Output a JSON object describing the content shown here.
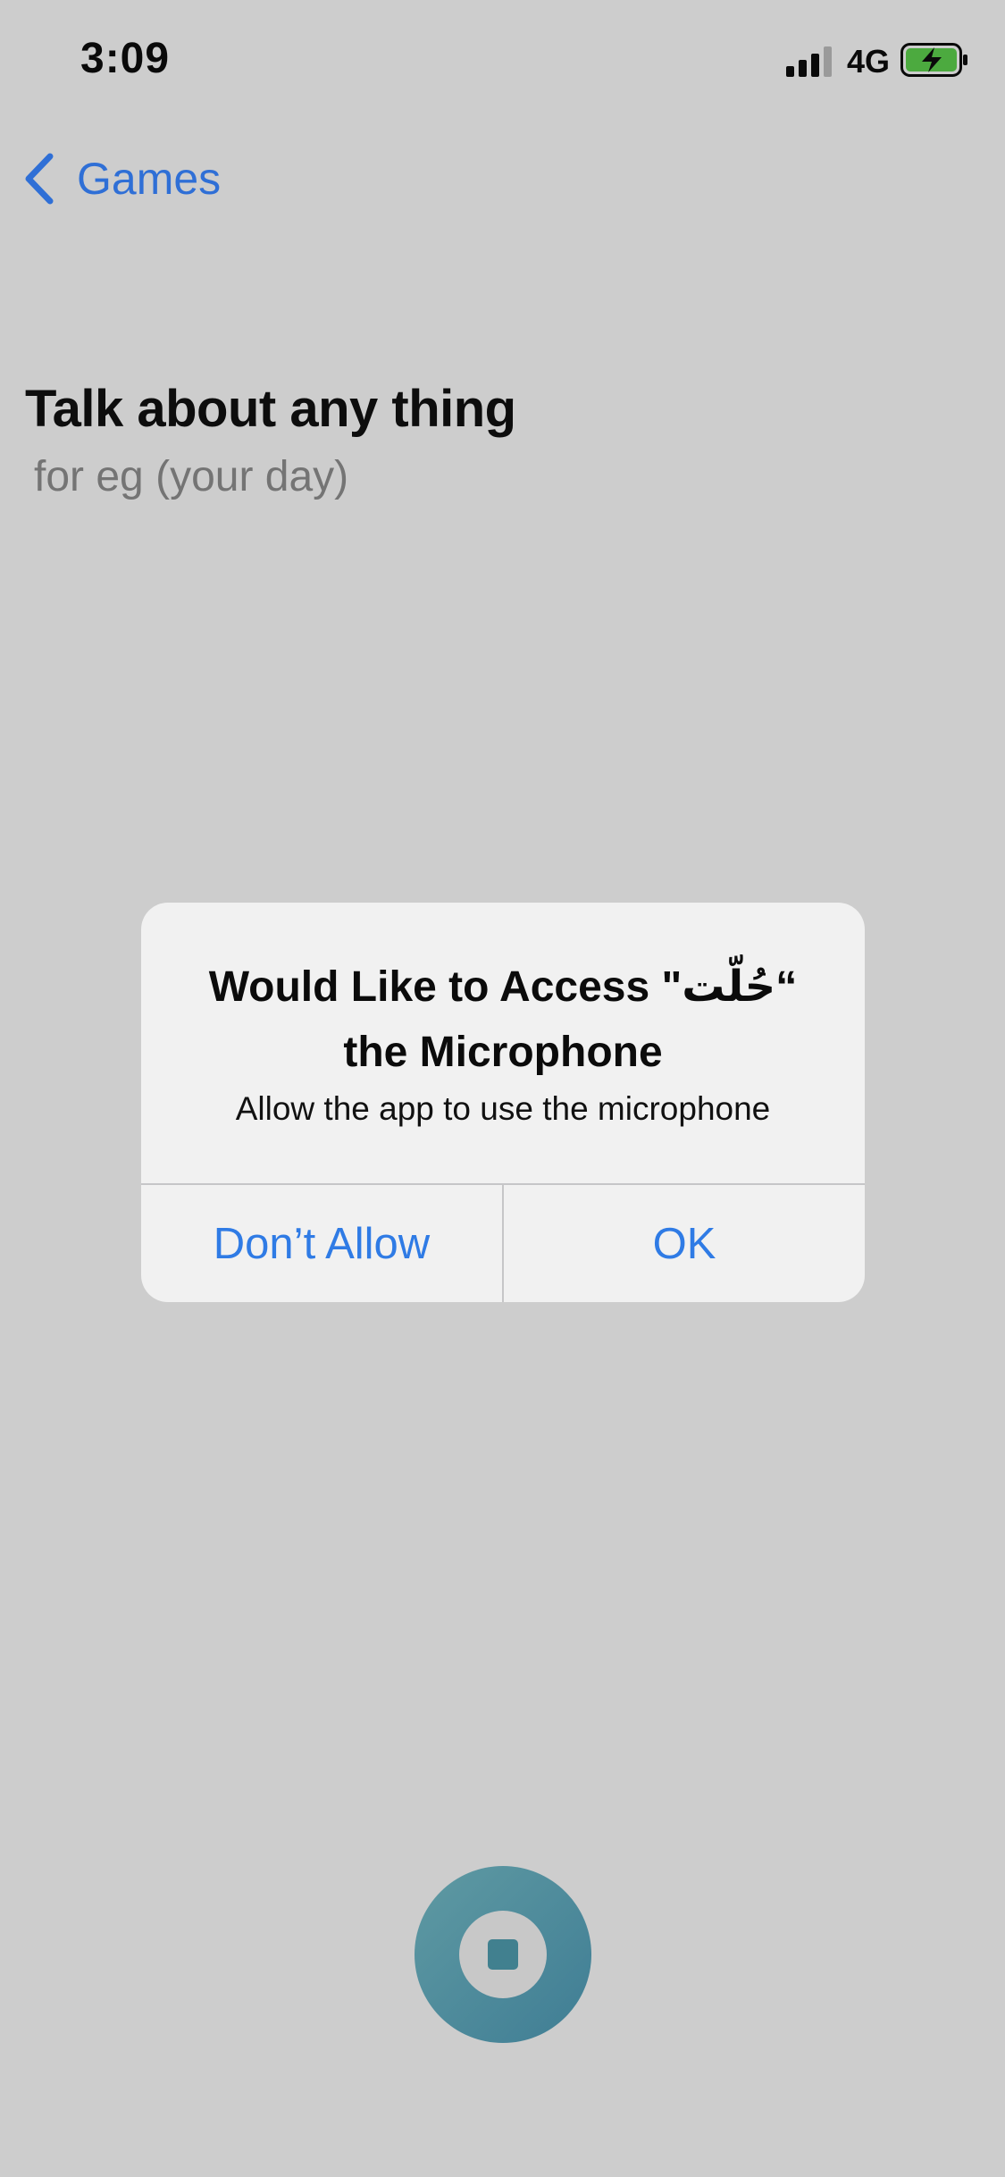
{
  "status_bar": {
    "time": "3:09",
    "network": "4G",
    "icons": [
      "signal-icon",
      "battery-charging-icon"
    ]
  },
  "nav": {
    "back_label": "Games",
    "icon": "chevron-left-icon"
  },
  "prompt": {
    "title": "Talk about any thing",
    "subtitle": "for eg (your day)"
  },
  "alert": {
    "title_line1": "Would Like to Access \"حُلّت“",
    "title_line2": "the Microphone",
    "message": "Allow the app to use the microphone",
    "deny_label": "Don’t Allow",
    "ok_label": "OK"
  },
  "record": {
    "icon": "stop-icon"
  },
  "colors": {
    "background": "#cdcdcd",
    "accent": "#2f7be5",
    "record_button": "#4a8a9a"
  }
}
